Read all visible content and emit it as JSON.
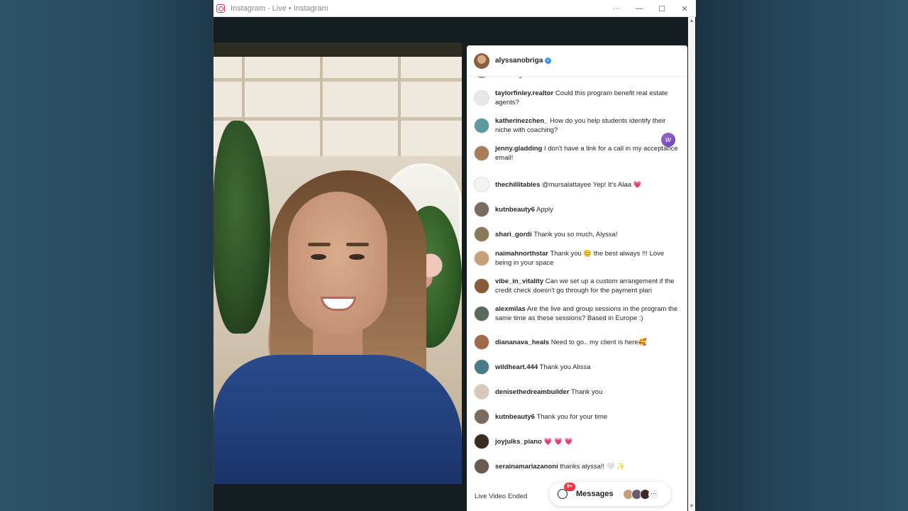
{
  "window": {
    "title": "Instagram - Live • Instagram",
    "controls": {
      "more": "···",
      "minimize": "—",
      "maximize": "☐",
      "close": "✕"
    }
  },
  "header": {
    "username": "alyssanobriga",
    "verified_mark": "✓"
  },
  "partial_comment": "coaching cohort ♥ ♥",
  "comments": [
    {
      "user": "taylorfinley.realtor",
      "text": "Could this program benefit real estate agents?",
      "avatar_color": "#e8e8e8"
    },
    {
      "user": "katherinezchen_",
      "text": "How do you help students identify their niche with coaching?",
      "avatar_color": "#5b9aa0"
    },
    {
      "user": "jenny.gladding",
      "text": "I don't have a link for a call in my acceptance email!",
      "avatar_color": "#a87c5a"
    },
    {
      "user": "thechillitables",
      "text": "@mursalattayee Yep! It's Alaa 💗",
      "avatar_color": "#f4f4f4"
    },
    {
      "user": "kutnbeauty6",
      "text": "Apply",
      "avatar_color": "#7a6a60"
    },
    {
      "user": "shari_gordi",
      "text": "Thank you so much, Alyssa!",
      "avatar_color": "#8a7a5a"
    },
    {
      "user": "naimahnorthstar",
      "text": "Thank you 😊 the best always !!! Love being in your space",
      "avatar_color": "#c8a078"
    },
    {
      "user": "vibe_in_vitality",
      "text": "Can we set up a custom arrangement if the credit check doesn't go through for the payment plan",
      "avatar_color": "#8a5a3a"
    },
    {
      "user": "alexmilas",
      "text": "Are the live and group sessions in the program the same time as these sessions? Based in Europe :)",
      "avatar_color": "#5a6a5a"
    },
    {
      "user": "diananava_heals",
      "text": "Need to go.. my client is here🥰",
      "avatar_color": "#a06a4a"
    },
    {
      "user": "wildheart.444",
      "text": "Thank you Alissa",
      "avatar_color": "#4a7a8a"
    },
    {
      "user": "denisethedreambuilder",
      "text": "Thank you",
      "avatar_color": "#d8c8b8"
    },
    {
      "user": "kutnbeauty6",
      "text": "Thank you for your time",
      "avatar_color": "#7a6a60"
    },
    {
      "user": "joyjulks_piano",
      "text": "💗 💗 💗",
      "avatar_color": "#3a2a20"
    },
    {
      "user": "serainamariazanoni",
      "text": "thanks alyssa!! 🤍 ✨",
      "avatar_color": "#6a5a50"
    }
  ],
  "side_badge": "w",
  "footer": {
    "status": "Live Video Ended",
    "messages_label": "Messages",
    "messages_badge": "9+",
    "more": "···"
  },
  "colors": {
    "accent_blue": "#3897f0",
    "badge_red": "#ff3040",
    "instagram_pink": "#e1306c"
  },
  "icons": {
    "app": "instagram-icon",
    "verified": "verified-badge-icon",
    "messages": "messenger-icon"
  }
}
